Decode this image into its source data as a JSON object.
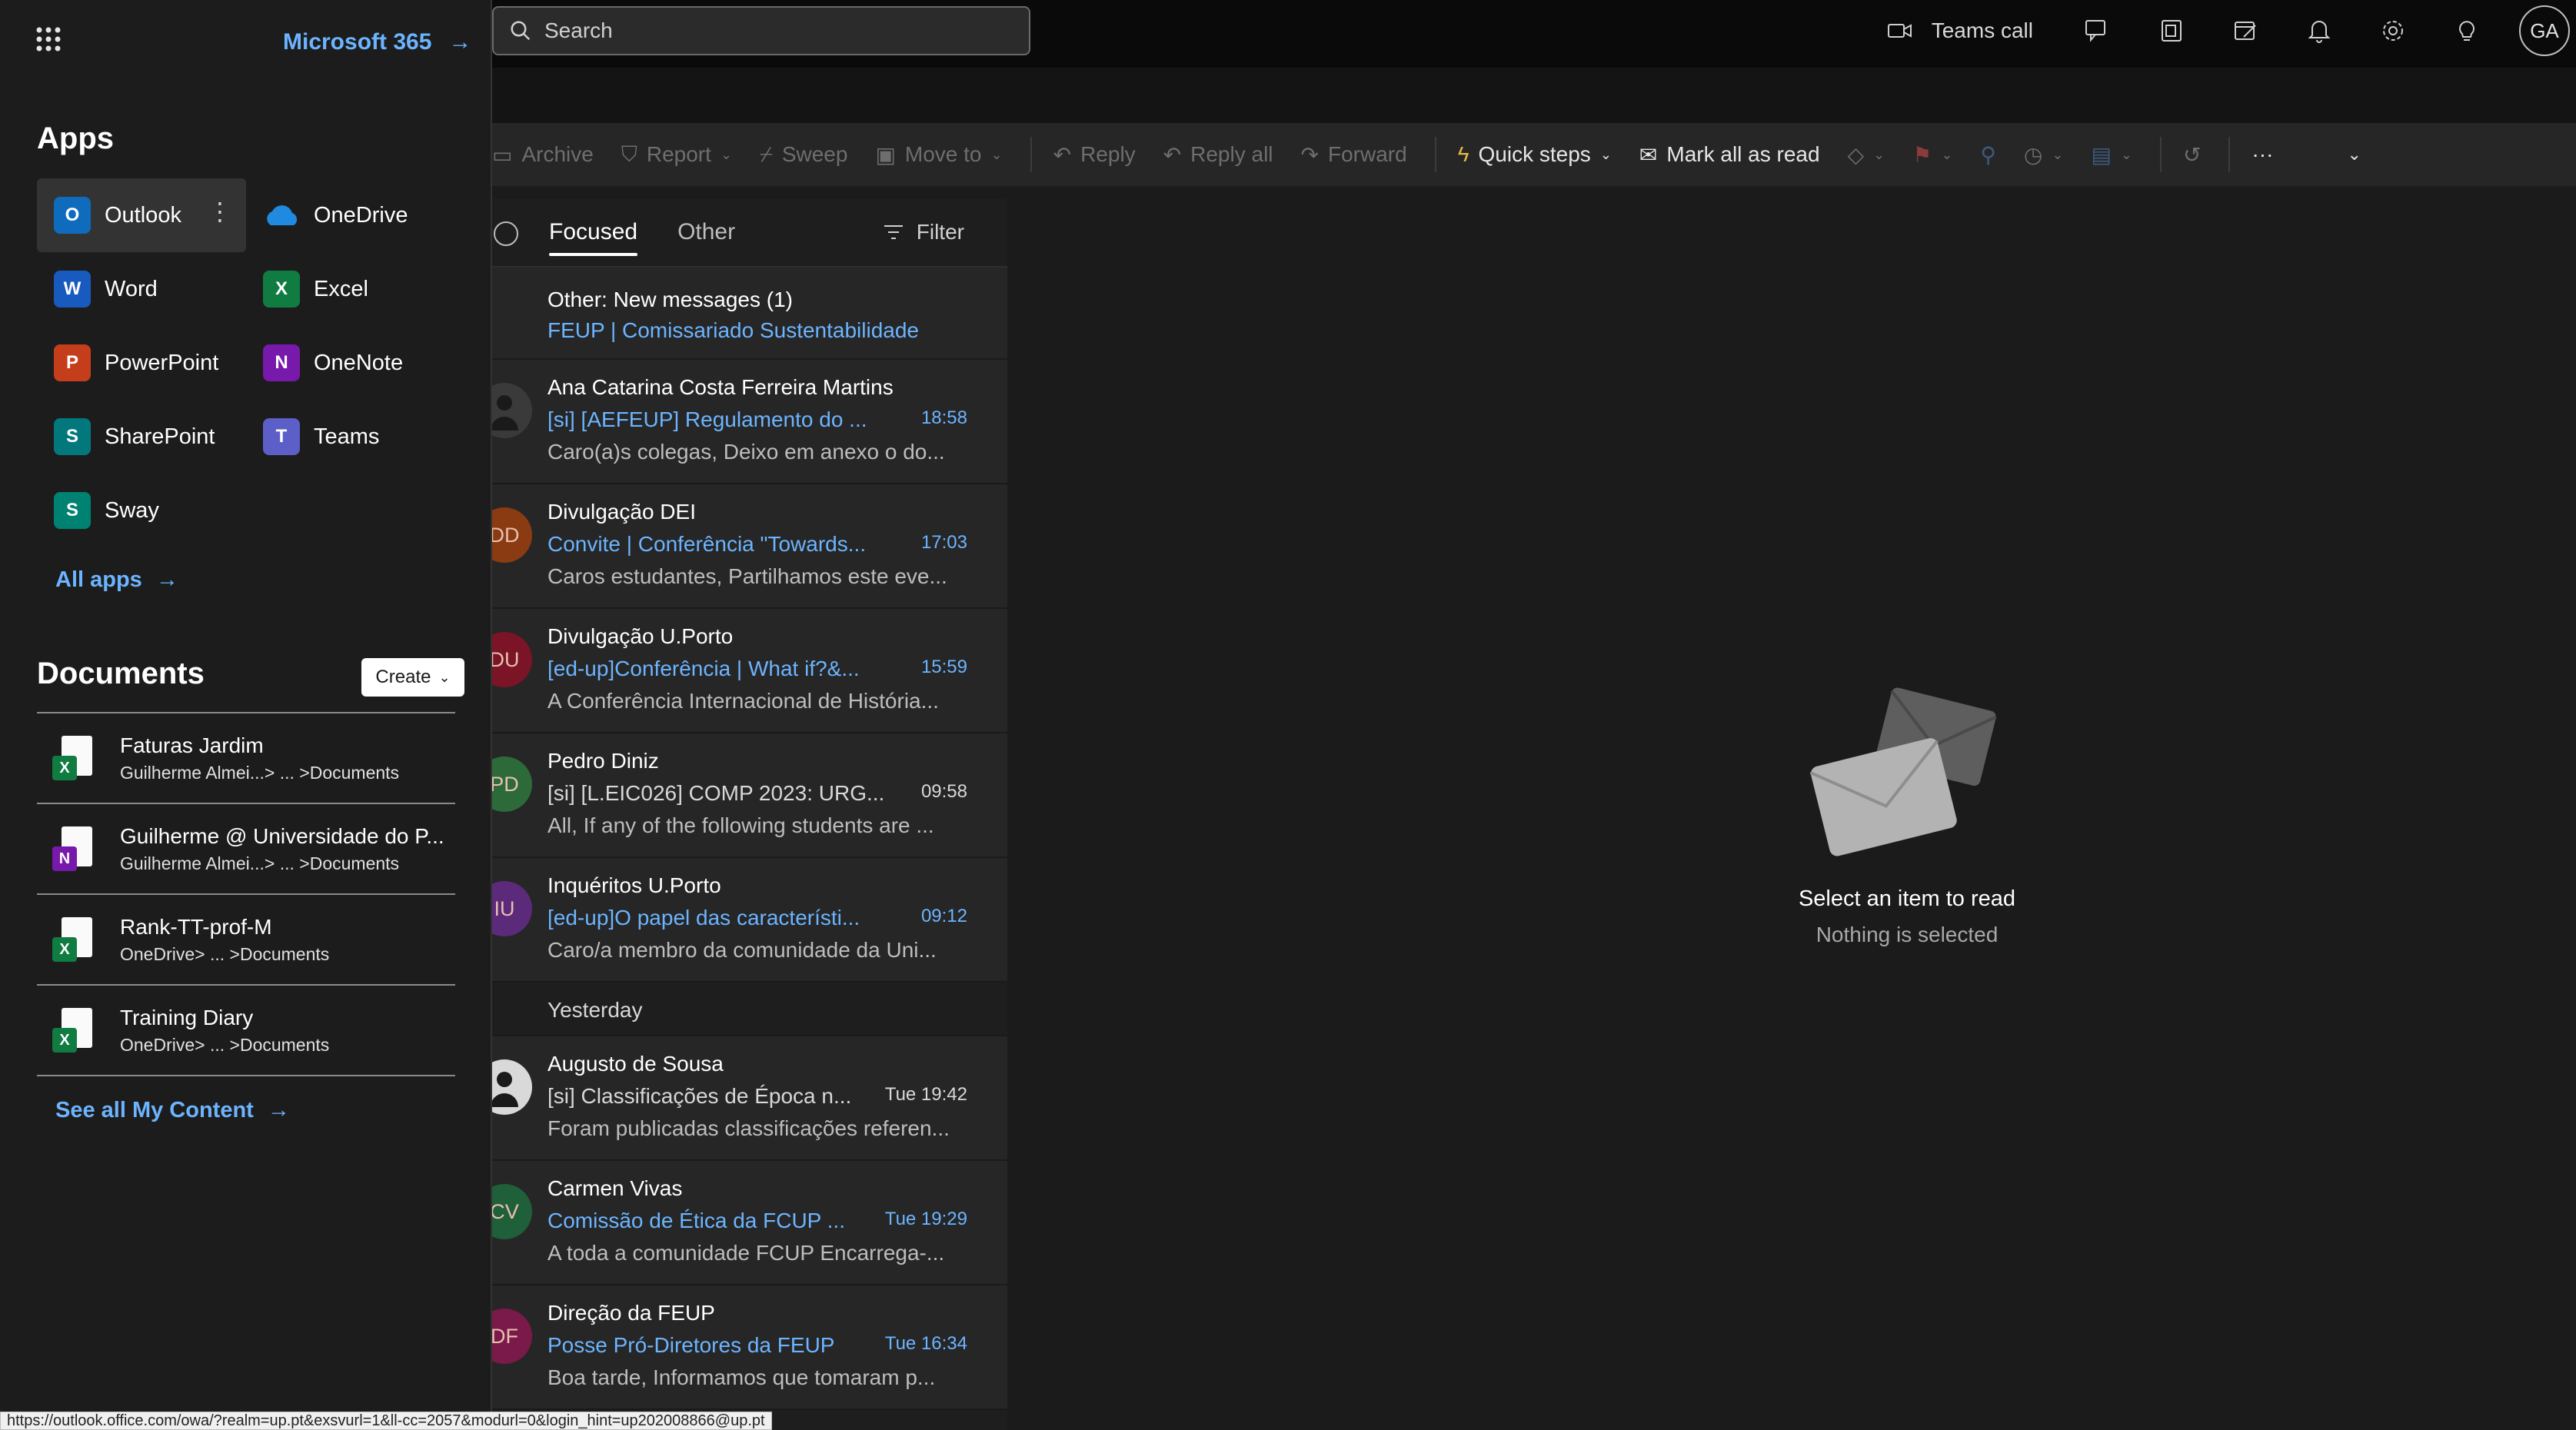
{
  "launcher": {
    "brand": "Microsoft 365",
    "apps_heading": "Apps",
    "apps": [
      {
        "label": "Outlook",
        "icon": "outlook-icon",
        "color": "#0f6cbd",
        "letter": "O"
      },
      {
        "label": "OneDrive",
        "icon": "onedrive-icon",
        "color": "#1f8ae0",
        "letter": ""
      },
      {
        "label": "Word",
        "icon": "word-icon",
        "color": "#185abd",
        "letter": "W"
      },
      {
        "label": "Excel",
        "icon": "excel-icon",
        "color": "#107c41",
        "letter": "X"
      },
      {
        "label": "PowerPoint",
        "icon": "powerpoint-icon",
        "color": "#c43e1c",
        "letter": "P"
      },
      {
        "label": "OneNote",
        "icon": "onenote-icon",
        "color": "#7719aa",
        "letter": "N"
      },
      {
        "label": "SharePoint",
        "icon": "sharepoint-icon",
        "color": "#03787c",
        "letter": "S"
      },
      {
        "label": "Teams",
        "icon": "teams-icon",
        "color": "#5b5fc7",
        "letter": "T"
      },
      {
        "label": "Sway",
        "icon": "sway-icon",
        "color": "#008272",
        "letter": "S"
      }
    ],
    "all_apps": "All apps",
    "documents_heading": "Documents",
    "create_label": "Create",
    "documents": [
      {
        "name": "Faturas Jardim",
        "path": "Guilherme Almei...> ... >Documents",
        "type": "excel"
      },
      {
        "name": "Guilherme @ Universidade do P...",
        "path": "Guilherme Almei...> ... >Documents",
        "type": "onenote"
      },
      {
        "name": "Rank-TT-prof-M",
        "path": "OneDrive> ... >Documents",
        "type": "excel"
      },
      {
        "name": "Training Diary",
        "path": "OneDrive> ... >Documents",
        "type": "excel"
      }
    ],
    "see_all": "See all My Content"
  },
  "search": {
    "placeholder": "Search"
  },
  "topbar": {
    "teams_call": "Teams call",
    "avatar_initials": "GA"
  },
  "ribbon": {
    "archive": "Archive",
    "report": "Report",
    "sweep": "Sweep",
    "move_to": "Move to",
    "reply": "Reply",
    "reply_all": "Reply all",
    "forward": "Forward",
    "quick_steps": "Quick steps",
    "mark_all_read": "Mark all as read"
  },
  "list": {
    "tab_focused": "Focused",
    "tab_other": "Other",
    "filter": "Filter",
    "notice": {
      "line1": "Other: New messages (1)",
      "line2": "FEUP | Comissariado Sustentabilidade"
    },
    "today": [
      {
        "sender": "Ana Catarina Costa Ferreira Martins",
        "subject": "[si] [AEFEUP] Regulamento do ...",
        "time": "18:58",
        "preview": "Caro(a)s colegas, Deixo em anexo o do...",
        "unread": true,
        "initials": "",
        "avcolor": "#3a3a3a"
      },
      {
        "sender": "Divulgação DEI",
        "subject": "Convite | Conferência \"Towards...",
        "time": "17:03",
        "preview": "Caros estudantes, Partilhamos este eve...",
        "unread": true,
        "initials": "DD",
        "avcolor": "#8a3b12"
      },
      {
        "sender": "Divulgação U.Porto",
        "subject": "[ed-up]Conferência | What if?&...",
        "time": "15:59",
        "preview": "A Conferência Internacional de História...",
        "unread": true,
        "initials": "DU",
        "avcolor": "#7a1426"
      },
      {
        "sender": "Pedro Diniz",
        "subject": "[si] [L.EIC026] COMP 2023: URG...",
        "time": "09:58",
        "preview": "All, If any of the following students are ...",
        "unread": false,
        "initials": "PD",
        "avcolor": "#2d6a3a"
      },
      {
        "sender": "Inquéritos U.Porto",
        "subject": "[ed-up]O papel das característi...",
        "time": "09:12",
        "preview": "Caro/a membro da comunidade da Uni...",
        "unread": true,
        "initials": "IU",
        "avcolor": "#5c2a7a"
      }
    ],
    "yesterday_label": "Yesterday",
    "yesterday": [
      {
        "sender": "Augusto de Sousa",
        "subject": "[si] Classificações de Época n...",
        "time": "Tue 19:42",
        "preview": "Foram publicadas classificações referen...",
        "unread": false,
        "initials": "",
        "avcolor": "#d9d9d9"
      },
      {
        "sender": "Carmen Vivas",
        "subject": "Comissão de Ética da FCUP ...",
        "time": "Tue 19:29",
        "preview": "A toda a comunidade FCUP Encarrega-...",
        "unread": true,
        "initials": "CV",
        "avcolor": "#1f5f3a"
      },
      {
        "sender": "Direção da FEUP",
        "subject": "Posse Pró-Diretores da FEUP",
        "time": "Tue 16:34",
        "preview": "Boa tarde, Informamos que tomaram p...",
        "unread": true,
        "initials": "DF",
        "avcolor": "#7a1a4a"
      }
    ]
  },
  "reading": {
    "title": "Select an item to read",
    "subtitle": "Nothing is selected"
  },
  "status_url": "https://outlook.office.com/owa/?realm=up.pt&exsvurl=1&ll-cc=2057&modurl=0&login_hint=up202008866@up.pt"
}
